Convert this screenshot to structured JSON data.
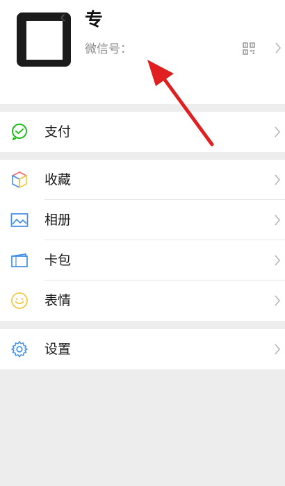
{
  "profile": {
    "name": "专",
    "wechat_id_label": "微信号："
  },
  "menu": {
    "pay": "支付",
    "favorites": "收藏",
    "album": "相册",
    "cards": "卡包",
    "stickers": "表情",
    "settings": "设置"
  },
  "icons": {
    "pay": "wechat-pay-icon",
    "favorites": "cube-icon",
    "album": "picture-icon",
    "cards": "card-icon",
    "stickers": "smiley-icon",
    "settings": "gear-icon"
  },
  "colors": {
    "page_background": "#ededed",
    "surface": "#ffffff",
    "annotation_arrow": "#e02020",
    "pay_green": "#09bb07",
    "icon_blue": "#3f8ee6",
    "smiley_yellow": "#f3c843"
  }
}
